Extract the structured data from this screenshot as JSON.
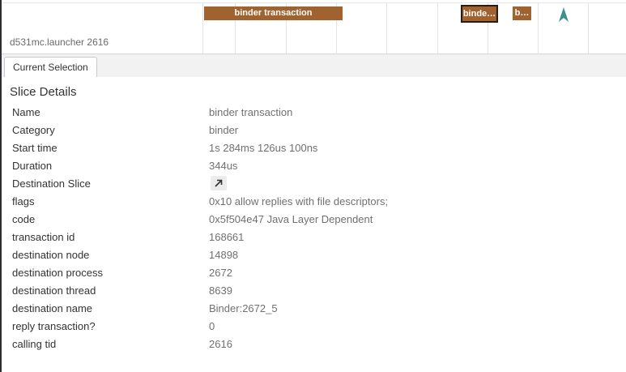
{
  "timeline": {
    "track_label": "d531mc.launcher 2616",
    "slices": [
      {
        "label": "binder transaction",
        "color": "#a0622f",
        "selected": false
      },
      {
        "label": "binde…",
        "color": "#a0622f",
        "selected": true
      },
      {
        "label": "b…",
        "color": "#a0622f",
        "selected": false
      }
    ],
    "flow_arrow_icon": "flow-arrow-up-icon",
    "flow_arrow_color": "#3c8f8c"
  },
  "tabs": [
    {
      "label": "Current Selection",
      "active": true
    }
  ],
  "details": {
    "title": "Slice Details",
    "rows": [
      {
        "key": "Name",
        "value": "binder transaction"
      },
      {
        "key": "Category",
        "value": "binder"
      },
      {
        "key": "Start time",
        "value": "1s 284ms 126us 100ns"
      },
      {
        "key": "Duration",
        "value": "344us"
      },
      {
        "key": "Destination Slice",
        "value": "",
        "icon": "go-to-slice-arrow-icon"
      },
      {
        "key": "flags",
        "value": "0x10 allow replies with file descriptors;"
      },
      {
        "key": "code",
        "value": "0x5f504e47 Java Layer Dependent"
      },
      {
        "key": "transaction id",
        "value": "168661"
      },
      {
        "key": "destination node",
        "value": "14898"
      },
      {
        "key": "destination process",
        "value": "2672"
      },
      {
        "key": "destination thread",
        "value": "8639"
      },
      {
        "key": "destination name",
        "value": "Binder:2672_5"
      },
      {
        "key": "reply transaction?",
        "value": "0"
      },
      {
        "key": "calling tid",
        "value": "2616"
      }
    ]
  }
}
